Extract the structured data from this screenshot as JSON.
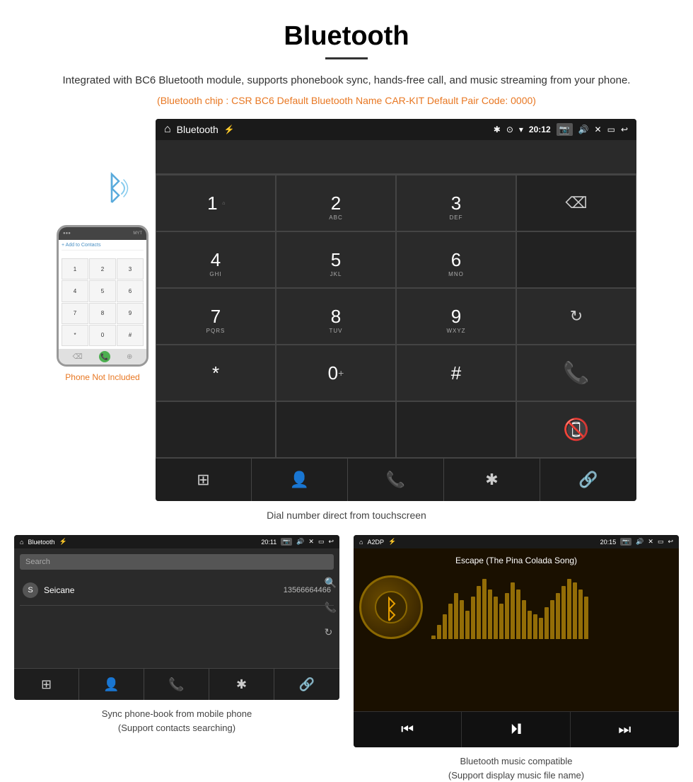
{
  "page": {
    "title": "Bluetooth",
    "description": "Integrated with BC6 Bluetooth module, supports phonebook sync, hands-free call, and music streaming from your phone.",
    "specs": "(Bluetooth chip : CSR BC6    Default Bluetooth Name CAR-KIT    Default Pair Code: 0000)",
    "dial_caption": "Dial number direct from touchscreen",
    "phone_not_included": "Phone Not Included",
    "bottom_left_caption": "Sync phone-book from mobile phone\n(Support contacts searching)",
    "bottom_right_caption": "Bluetooth music compatible\n(Support display music file name)"
  },
  "car_display": {
    "status_bar": {
      "title": "Bluetooth",
      "time": "20:12"
    }
  },
  "phonebook": {
    "status_bar": {
      "title": "Bluetooth",
      "time": "20:11"
    },
    "search_placeholder": "Search",
    "contacts": [
      {
        "letter": "S",
        "name": "Seicane",
        "number": "13566664466"
      }
    ]
  },
  "music": {
    "status_bar": {
      "title": "A2DP",
      "time": "20:15"
    },
    "song_title": "Escape (The Pina Colada Song)"
  },
  "dialpad": {
    "keys": [
      {
        "label": "1",
        "sub": "⌂"
      },
      {
        "label": "2",
        "sub": "ABC"
      },
      {
        "label": "3",
        "sub": "DEF"
      },
      {
        "label": "",
        "sub": ""
      },
      {
        "label": "4",
        "sub": "GHI"
      },
      {
        "label": "5",
        "sub": "JKL"
      },
      {
        "label": "6",
        "sub": "MNO"
      },
      {
        "label": "",
        "sub": ""
      },
      {
        "label": "7",
        "sub": "PQRS"
      },
      {
        "label": "8",
        "sub": "TUV"
      },
      {
        "label": "9",
        "sub": "WXYZ"
      },
      {
        "label": "reload"
      },
      {
        "label": "*",
        "sub": ""
      },
      {
        "label": "0+",
        "sub": ""
      },
      {
        "label": "#",
        "sub": ""
      },
      {
        "label": "call_green"
      },
      {
        "label": "",
        "sub": ""
      },
      {
        "label": "",
        "sub": ""
      },
      {
        "label": "",
        "sub": ""
      },
      {
        "label": "call_red"
      }
    ]
  },
  "viz_bars": [
    5,
    20,
    35,
    50,
    65,
    55,
    40,
    60,
    75,
    85,
    70,
    60,
    50,
    65,
    80,
    70,
    55,
    40,
    35,
    30,
    45,
    55,
    65,
    75,
    85,
    80,
    70,
    60
  ]
}
